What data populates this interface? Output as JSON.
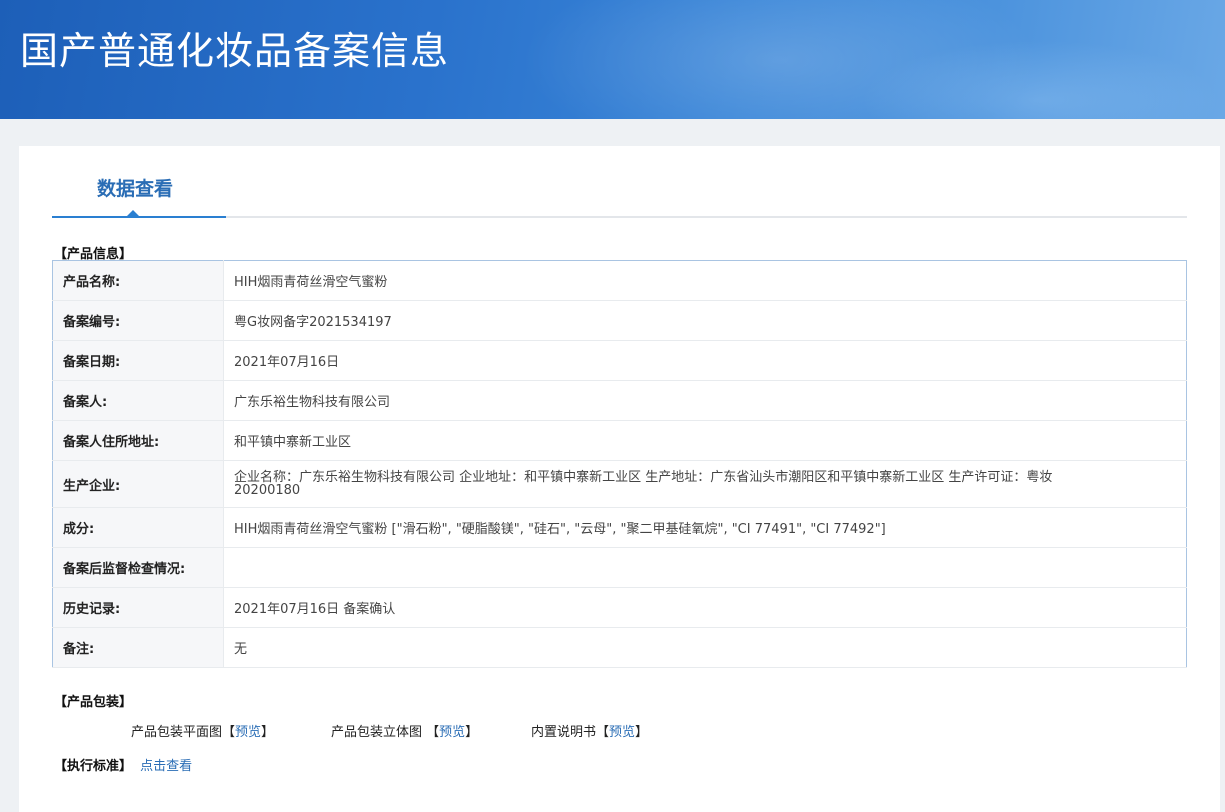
{
  "header": {
    "title": "国产普通化妆品备案信息"
  },
  "tabs": [
    {
      "label": "数据查看"
    }
  ],
  "product_info": {
    "section_label": "【产品信息】",
    "rows": [
      {
        "key": "产品名称:",
        "value": "HIH烟雨青荷丝滑空气蜜粉"
      },
      {
        "key": "备案编号:",
        "value": "粤G妆网备字2021534197"
      },
      {
        "key": "备案日期:",
        "value": "2021年07月16日"
      },
      {
        "key": "备案人:",
        "value": "广东乐裕生物科技有限公司"
      },
      {
        "key": "备案人住所地址:",
        "value": "和平镇中寨新工业区"
      },
      {
        "key": "生产企业:",
        "value": "企业名称：广东乐裕生物科技有限公司 企业地址：和平镇中寨新工业区 生产地址：广东省汕头市潮阳区和平镇中寨新工业区 生产许可证：粤妆 20200180"
      },
      {
        "key": "成分:",
        "value": "HIH烟雨青荷丝滑空气蜜粉 [\"滑石粉\", \"硬脂酸镁\", \"硅石\", \"云母\", \"聚二甲基硅氧烷\", \"CI 77491\", \"CI 77492\"]"
      },
      {
        "key": "备案后监督检查情况:",
        "value": ""
      },
      {
        "key": "历史记录:",
        "value": "2021年07月16日 备案确认"
      },
      {
        "key": "备注:",
        "value": "无"
      }
    ]
  },
  "packaging": {
    "section_label": "【产品包装】",
    "items": [
      {
        "label": "产品包装平面图",
        "bracket_open": "【",
        "link": "预览",
        "bracket_close": "】"
      },
      {
        "label": "产品包装立体图 ",
        "bracket_open": "【",
        "link": "预览",
        "bracket_close": "】"
      },
      {
        "label": "内置说明书",
        "bracket_open": "【",
        "link": "预览",
        "bracket_close": "】"
      }
    ]
  },
  "standard": {
    "section_label": "【执行标准】",
    "link": "点击查看"
  },
  "colors": {
    "accent": "#2a6db5",
    "banner": "#2a72cc",
    "table_border": "#a9c4e2"
  }
}
